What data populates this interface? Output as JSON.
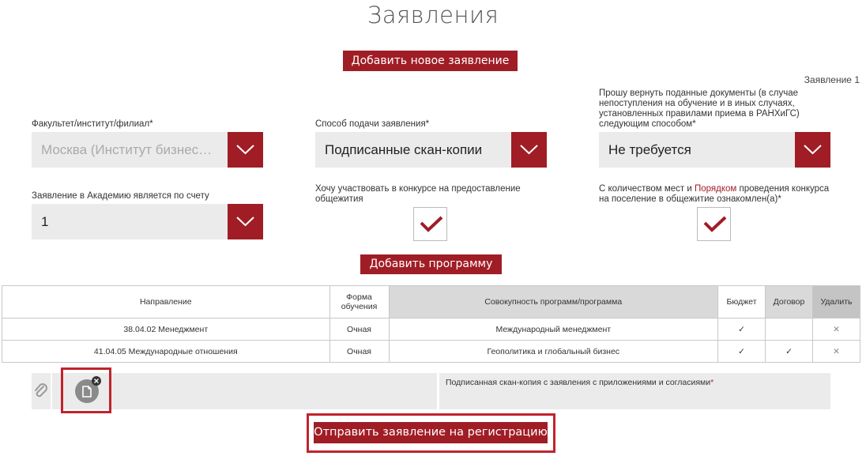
{
  "page": {
    "title": "Заявления"
  },
  "buttons": {
    "add_application": "Добавить новое заявление",
    "add_program": "Добавить программу",
    "submit": "Отправить заявление на регистрацию"
  },
  "application_number": "Заявление 1",
  "form": {
    "faculty": {
      "label": "Факультет/институт/филиал*",
      "value": "Москва (Институт бизнес…"
    },
    "submission_method": {
      "label": "Способ подачи заявления*",
      "value": "Подписанные скан-копии"
    },
    "return_docs": {
      "label_lines": [
        "Прошу вернуть поданные документы (в случае",
        "непоступления на обучение и в иных случаях,",
        "установленных правилами приема в РАНХиГС)",
        "следующим способом*"
      ],
      "value": "Не требуется"
    },
    "account": {
      "label": "Заявление в Академию является по счету",
      "value": "1"
    },
    "dormitory": {
      "label_lines": [
        "Хочу участвовать в конкурсе на предоставление",
        "общежития"
      ],
      "checked": true
    },
    "dormitory_rules": {
      "label_prefix": "С количеством мест и ",
      "label_link": "Порядком",
      "label_suffix": " проведения конкурса",
      "label_line2": "на поселение в общежитие ознакомлен(а)*",
      "checked": true
    }
  },
  "table": {
    "headers": {
      "direction": "Направление",
      "form_line1": "Форма",
      "form_line2": "обучения",
      "program": "Совокупность программ/программа",
      "budget": "Бюджет",
      "contract": "Договор",
      "delete": "Удалить"
    },
    "rows": [
      {
        "direction": "38.04.02 Менеджмент",
        "form": "Очная",
        "program": "Международный менеджмент",
        "budget": "✓",
        "contract": "",
        "delete": "✕"
      },
      {
        "direction": "41.04.05 Международные отношения",
        "form": "Очная",
        "program": "Геополитика и глобальный бизнес",
        "budget": "✓",
        "contract": "✓",
        "delete": "✕"
      }
    ]
  },
  "attachment": {
    "clip_icon": "paperclip-icon",
    "file_icon": "file-icon",
    "remove_icon": "close-icon",
    "description": "Подписанная скан-копия с заявления с приложениями и согласиями",
    "required_mark": "*"
  },
  "colors": {
    "accent": "#a01d26",
    "field_bg": "#ebebeb",
    "highlight": "#c1232b"
  }
}
